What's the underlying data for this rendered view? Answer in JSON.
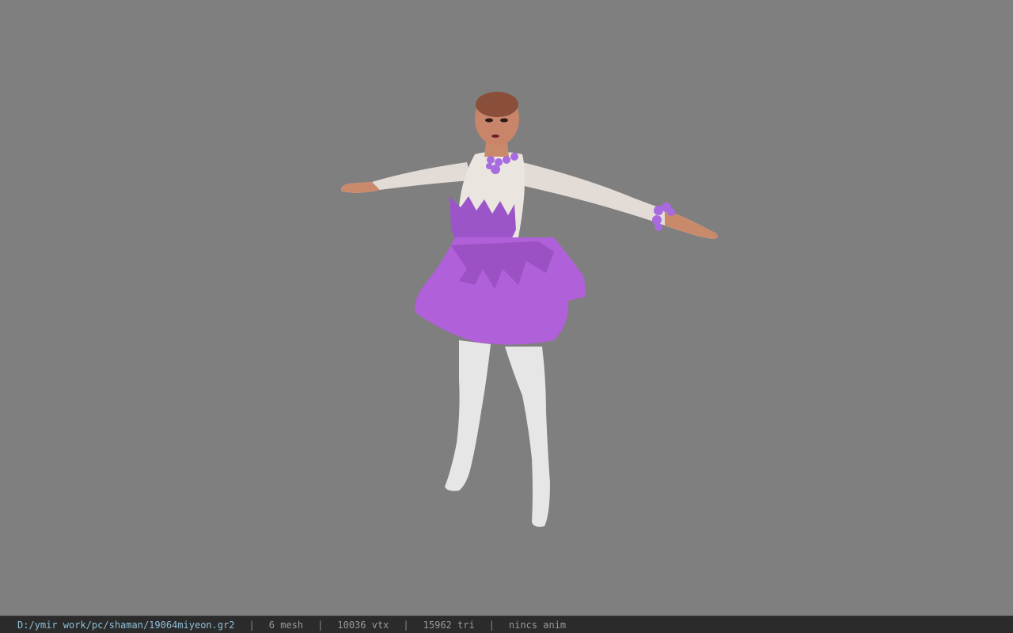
{
  "viewport": {
    "background_color": "#7f7f7f",
    "model": {
      "description_icon": "character-model-icon",
      "dress_color": "#b060d8",
      "accessory_color": "#a86ae0",
      "top_color": "#e8e2dc",
      "boots_color": "#e6e6e6",
      "skin_color": "#c8856a"
    }
  },
  "status_bar": {
    "file_path": "D:/ymir work/pc/shaman/19064miyeon.gr2",
    "separator": "|",
    "mesh": "6 mesh",
    "vertices": "10036 vtx",
    "triangles": "15962 tri",
    "anim": "nincs anim",
    "path_color": "#8fc0d8",
    "text_color": "#9a9a9a",
    "background_color": "#2b2b2b"
  }
}
